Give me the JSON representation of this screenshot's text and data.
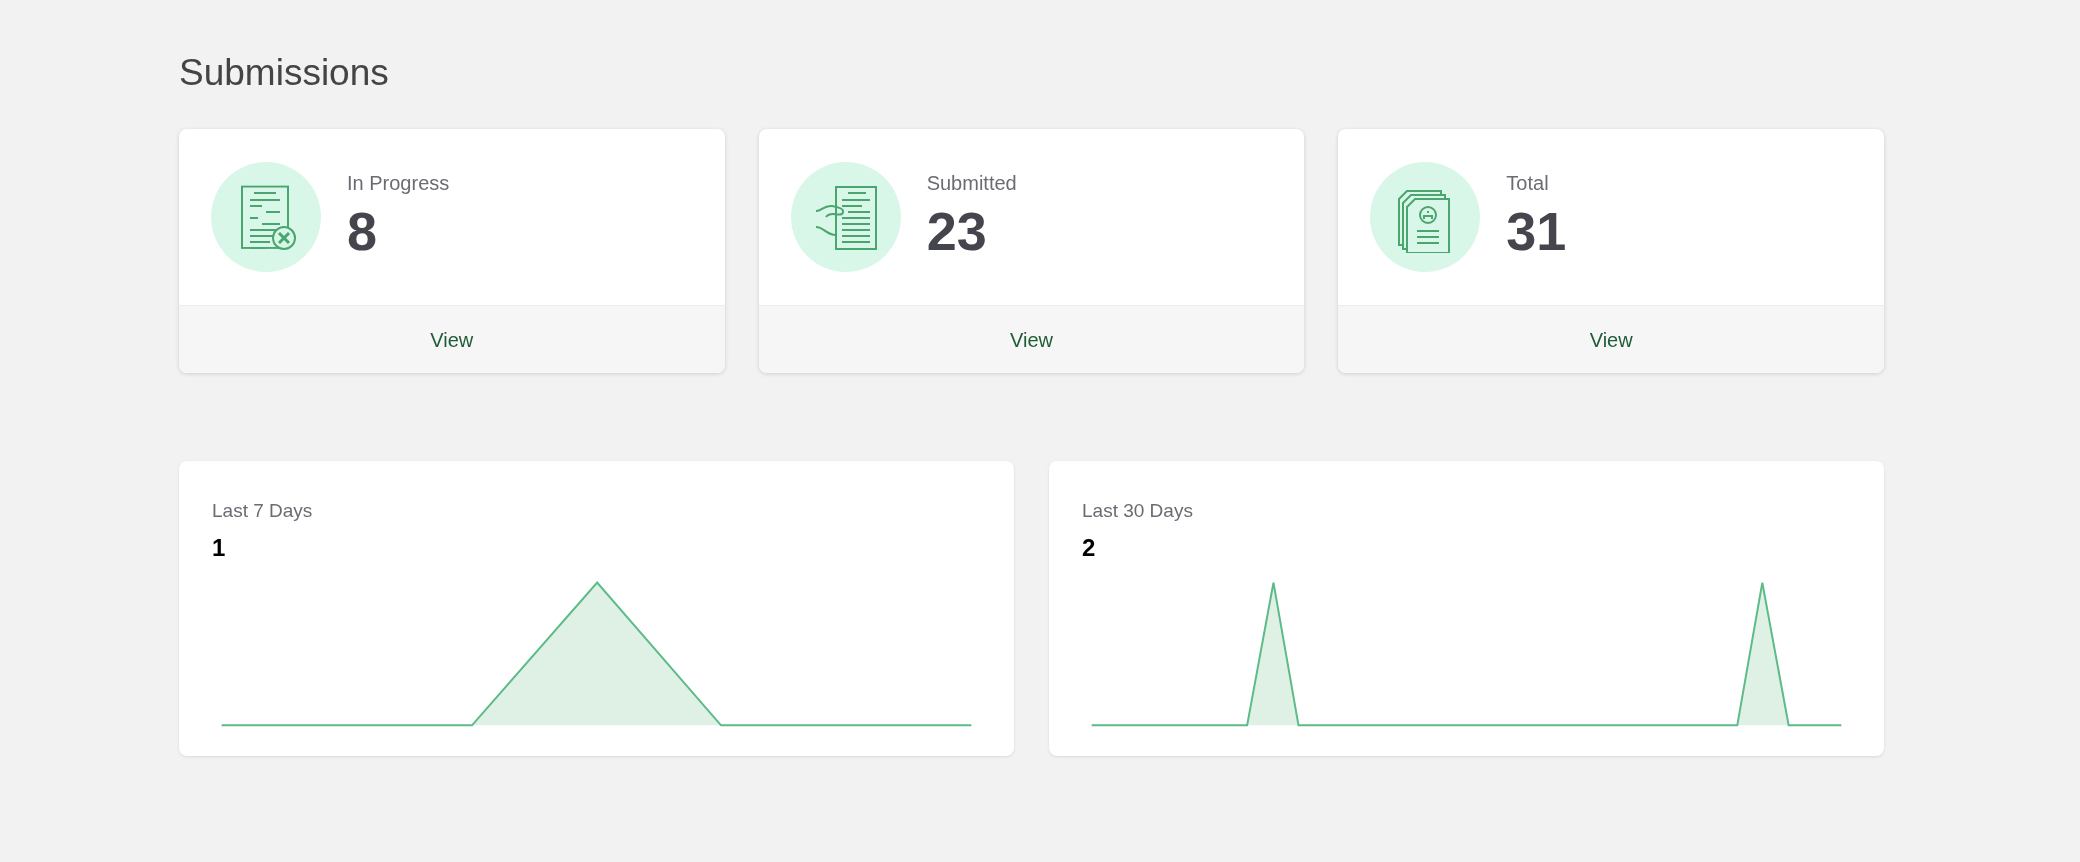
{
  "page": {
    "title": "Submissions"
  },
  "stat_cards": [
    {
      "kind": "document-x",
      "label": "In Progress",
      "count": "8",
      "action": "View"
    },
    {
      "kind": "hand-document",
      "label": "Submitted",
      "count": "23",
      "action": "View"
    },
    {
      "kind": "document-stack",
      "label": "Total",
      "count": "31",
      "action": "View"
    }
  ],
  "trend_cards": [
    {
      "kind": "single-peak",
      "label": "Last 7 Days",
      "count": "1"
    },
    {
      "kind": "twin-peak",
      "label": "Last 30 Days",
      "count": "2"
    }
  ]
}
